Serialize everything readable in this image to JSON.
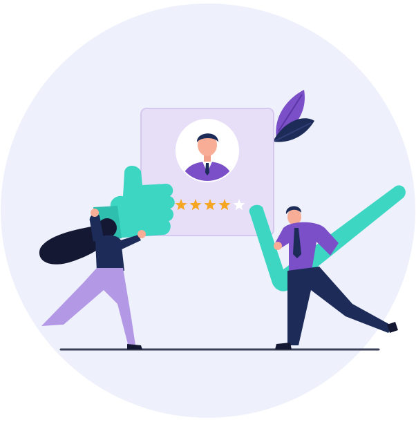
{
  "illustration": {
    "subject": "customer-review",
    "icons": [
      "thumbs-up-icon",
      "check-mark-icon",
      "user-avatar-icon",
      "leaf-icon",
      "star-icon"
    ],
    "rating": {
      "value": 4,
      "max": 5
    },
    "colors": {
      "background_circle": "#eef1fc",
      "card": "#e7dff7",
      "card_border": "#d4c8ef",
      "accent_teal": "#3dd6c3",
      "accent_purple": "#7a4fc7",
      "navy": "#1d2b59",
      "star_filled": "#f5a623",
      "star_empty": "#ffffff",
      "ground": "#3a3f55"
    }
  }
}
